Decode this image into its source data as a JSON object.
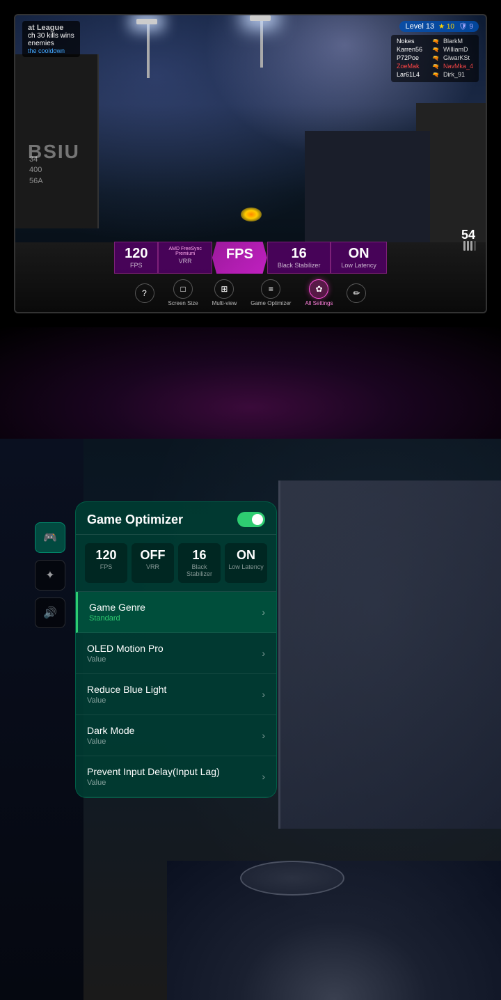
{
  "top_game": {
    "title": "at League",
    "kill_info": "ch 30 kills wins",
    "enemies_label": "enemies",
    "cooldown_label": "the cooldown",
    "level": "Level 13",
    "star_count": "10",
    "shield_count": "9",
    "scoreboard": [
      {
        "name": "Nokes",
        "weapon": "🔫",
        "opponent": "BlarkM"
      },
      {
        "name": "Karren56",
        "weapon": "🔫",
        "opponent": "WilliamD"
      },
      {
        "name": "P72Poe",
        "weapon": "🔫",
        "opponent": "GiwarKSt"
      },
      {
        "name": "ZoeMak",
        "weapon": "🔫",
        "opponent": "NavMka_4",
        "highlight": true
      },
      {
        "name": "Lar61L4",
        "weapon": "🔫",
        "opponent": "Dirk_91"
      }
    ],
    "stats": [
      {
        "value": "120",
        "label": "FPS"
      },
      {
        "value": "AMD FreeSync Premium",
        "sublabel": "VRR"
      },
      {
        "value": "FPS",
        "active": true
      },
      {
        "value": "16",
        "label": "Black Stabilizer"
      },
      {
        "value": "ON",
        "label": "Low Latency"
      }
    ],
    "menu": [
      {
        "icon": "?",
        "label": "",
        "active": false
      },
      {
        "icon": "□",
        "label": "Screen Size",
        "active": false
      },
      {
        "icon": "⊞",
        "label": "Multi-view",
        "active": false
      },
      {
        "icon": "≡",
        "label": "Game Optimizer",
        "active": false
      },
      {
        "icon": "✿",
        "label": "All Settings",
        "active": true
      },
      {
        "icon": "✏",
        "label": "",
        "active": false
      }
    ],
    "hud_bsiu": "BSIU",
    "hud_numbers": "34\n400\n56A",
    "ammo": "54"
  },
  "optimizer": {
    "title": "Game Optimizer",
    "toggle_state": "on",
    "stats": [
      {
        "value": "120",
        "label": "FPS"
      },
      {
        "value": "OFF",
        "label": "VRR"
      },
      {
        "value": "16",
        "label": "Black Stabilizer"
      },
      {
        "value": "ON",
        "label": "Low Latency"
      }
    ],
    "menu_items": [
      {
        "title": "Game Genre",
        "value": "Standard",
        "highlighted": true
      },
      {
        "title": "OLED Motion Pro",
        "value": "Value",
        "highlighted": false
      },
      {
        "title": "Reduce Blue Light",
        "value": "Value",
        "highlighted": false
      },
      {
        "title": "Dark Mode",
        "value": "Value",
        "highlighted": false
      },
      {
        "title": "Prevent Input Delay(Input Lag)",
        "value": "Value",
        "highlighted": false
      }
    ]
  },
  "sidebar": {
    "icons": [
      {
        "icon": "🎮",
        "label": "game-controller",
        "active": true
      },
      {
        "icon": "✦",
        "label": "star-settings",
        "active": false
      },
      {
        "icon": "🔊",
        "label": "volume",
        "active": false
      }
    ]
  }
}
